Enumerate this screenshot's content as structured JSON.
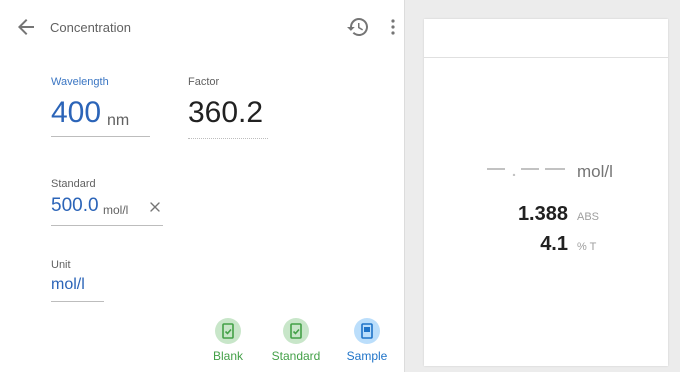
{
  "appbar": {
    "title": "Concentration",
    "back_icon": "arrow-back-icon",
    "history_icon": "history-icon",
    "menu_icon": "more-vert-icon"
  },
  "wavelength": {
    "label": "Wavelength",
    "value": "400",
    "unit": "nm"
  },
  "factor": {
    "label": "Factor",
    "value": "360.2"
  },
  "standard": {
    "label": "Standard",
    "value": "500.0",
    "unit": "mol/l",
    "clear_icon": "close-icon"
  },
  "unit_field": {
    "label": "Unit",
    "value": "mol/l"
  },
  "actions": [
    {
      "label": "Blank",
      "icon": "cuvette-check-icon",
      "color": "#43a047"
    },
    {
      "label": "Standard",
      "icon": "cuvette-check-icon",
      "color": "#43a047"
    },
    {
      "label": "Sample",
      "icon": "cuvette-icon",
      "color": "#1e73c8"
    }
  ],
  "results": {
    "concentration_placeholder": "–.––",
    "concentration_unit": "mol/l",
    "absorbance_value": "1.388",
    "absorbance_unit": "ABS",
    "transmittance_value": "4.1",
    "transmittance_unit": "% T"
  },
  "colors": {
    "accent_blue": "#2b64b8",
    "action_green": "#43a047",
    "action_blue": "#1e73c8"
  }
}
